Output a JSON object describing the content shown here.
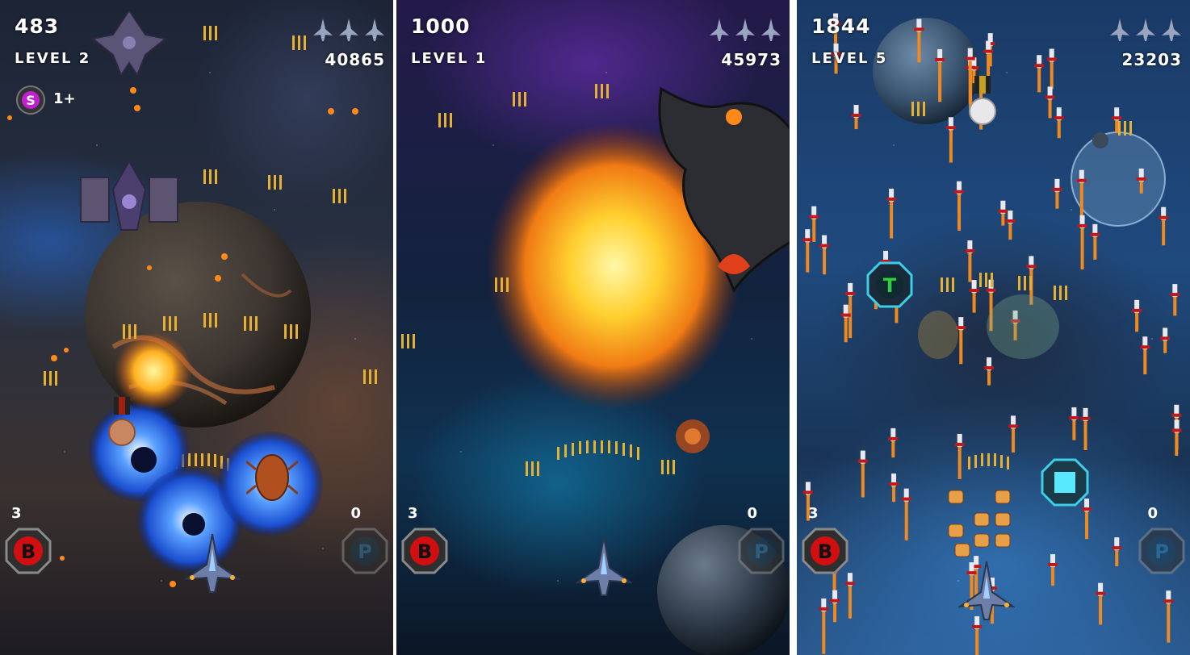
{
  "panels": [
    {
      "score": "483",
      "level": "LEVEL 2",
      "hiscore": "40865",
      "lives": 3,
      "shield": {
        "letter": "S",
        "count": "1+"
      },
      "bombs": "3",
      "bomb_label": "B",
      "powers": "0",
      "power_label": "P"
    },
    {
      "score": "1000",
      "level": "LEVEL 1",
      "hiscore": "45973",
      "lives": 3,
      "bombs": "3",
      "bomb_label": "B",
      "powers": "0",
      "power_label": "P"
    },
    {
      "score": "1844",
      "level": "LEVEL 5",
      "hiscore": "23203",
      "lives": 3,
      "bombs": "3",
      "bomb_label": "B",
      "powers": "0",
      "power_label": "P",
      "pickup_t": "T"
    }
  ],
  "colors": {
    "bomb_red": "#d10f10",
    "power_blue": "#2b7aa8",
    "shield_purple": "#c020d0",
    "bullet_gold": "#e8b030",
    "explosion": "#ffb020"
  }
}
